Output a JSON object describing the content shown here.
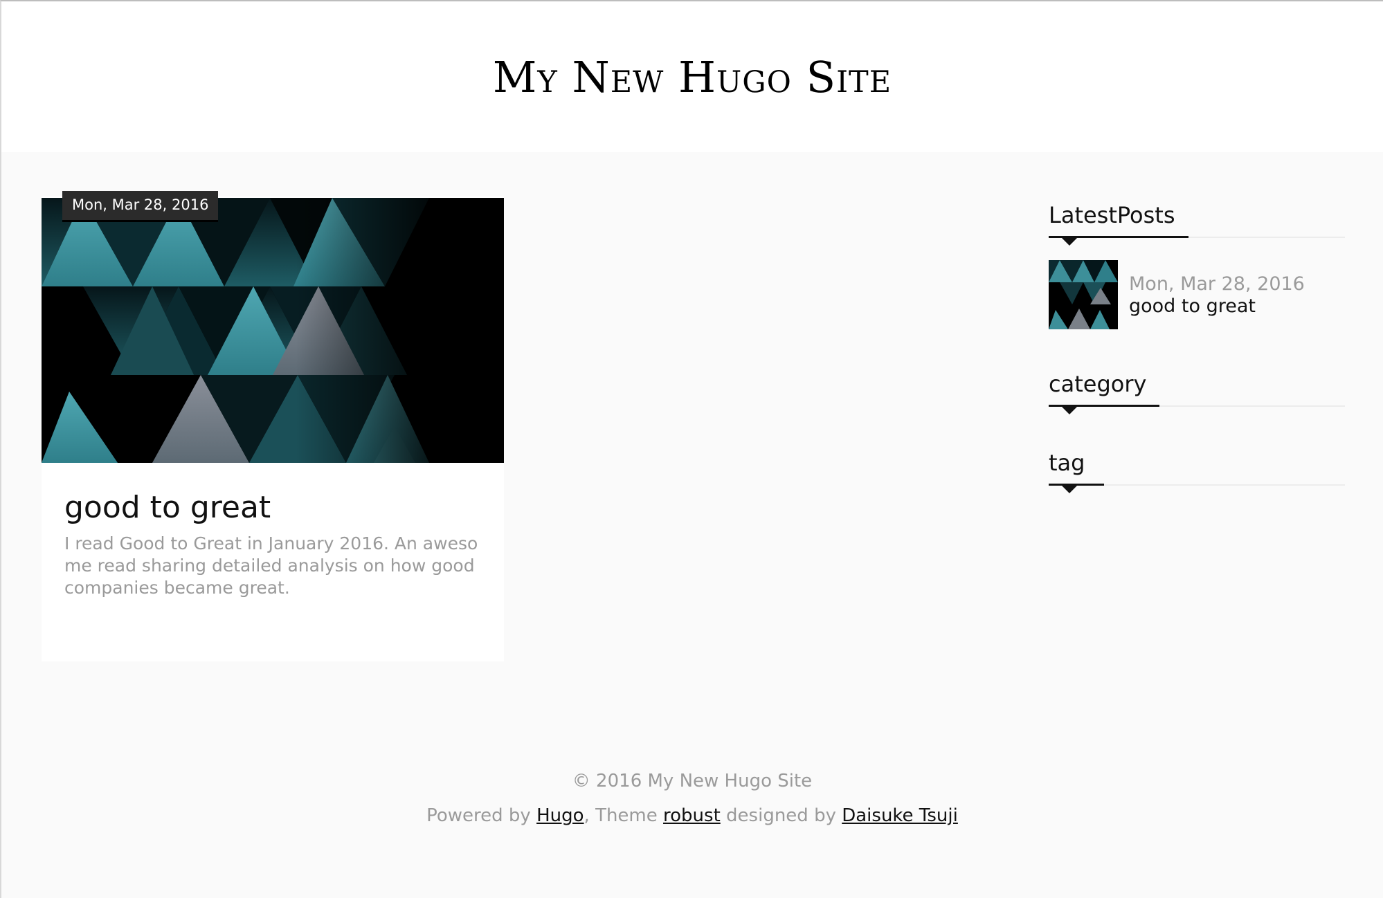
{
  "site": {
    "title": "My New Hugo Site"
  },
  "post": {
    "date": "Mon, Mar 28, 2016",
    "title": "good to great",
    "summary": "I read Good to Great in January 2016. An awesome read sharing detailed analysis on how good companies became great."
  },
  "sidebar": {
    "latest_posts_title": "LatestPosts",
    "latest_posts": [
      {
        "date": "Mon, Mar 28, 2016",
        "title": "good to great"
      }
    ],
    "category_title": "category",
    "tag_title": "tag"
  },
  "footer": {
    "copyright": "© 2016 My New Hugo Site",
    "powered_prefix": "Powered by ",
    "powered_link": "Hugo",
    "theme_prefix": ", Theme ",
    "theme_link": "robust",
    "designed_prefix": " designed by ",
    "designer_link": "Daisuke Tsuji"
  },
  "colors": {
    "teal": "#3d8f99",
    "teal_dark": "#12363c",
    "grey_purple": "#7a8088",
    "background": "#fafafa"
  }
}
